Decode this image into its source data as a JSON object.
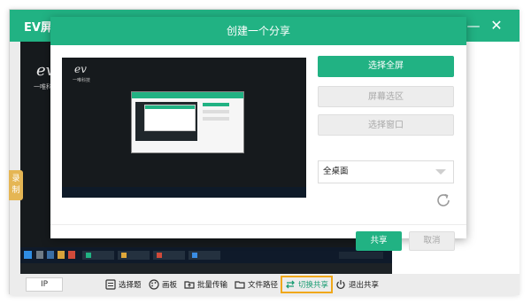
{
  "app": {
    "title": "EV屏幕共享",
    "minimize_icon": "minimize-icon",
    "close_icon": "close-icon",
    "side_tag": "录制",
    "background": {
      "logo": "ev",
      "logo_sub": "一唯科技"
    }
  },
  "toolbar": {
    "ip_label": "IP",
    "items": [
      {
        "label": "选择题",
        "icon": "list-icon"
      },
      {
        "label": "画板",
        "icon": "palette-icon"
      },
      {
        "label": "批量传输",
        "icon": "folder-upload-icon"
      },
      {
        "label": "文件路径",
        "icon": "folder-icon"
      },
      {
        "label": "切换共享",
        "icon": "swap-icon"
      },
      {
        "label": "退出共享",
        "icon": "power-icon"
      }
    ]
  },
  "dialog": {
    "title": "创建一个分享",
    "preview": {
      "logo": "ev",
      "logo_sub": "一唯科技"
    },
    "buttons": {
      "full_screen": "选择全屏",
      "screen_area": "屏幕选区",
      "window": "选择窗口"
    },
    "select": {
      "value": "全桌面"
    },
    "refresh_icon": "refresh-icon",
    "share_label": "共享",
    "cancel_label": "取消"
  },
  "colors": {
    "accent": "#21b283",
    "highlight": "#f0a81b",
    "side_tag": "#e5b654"
  }
}
